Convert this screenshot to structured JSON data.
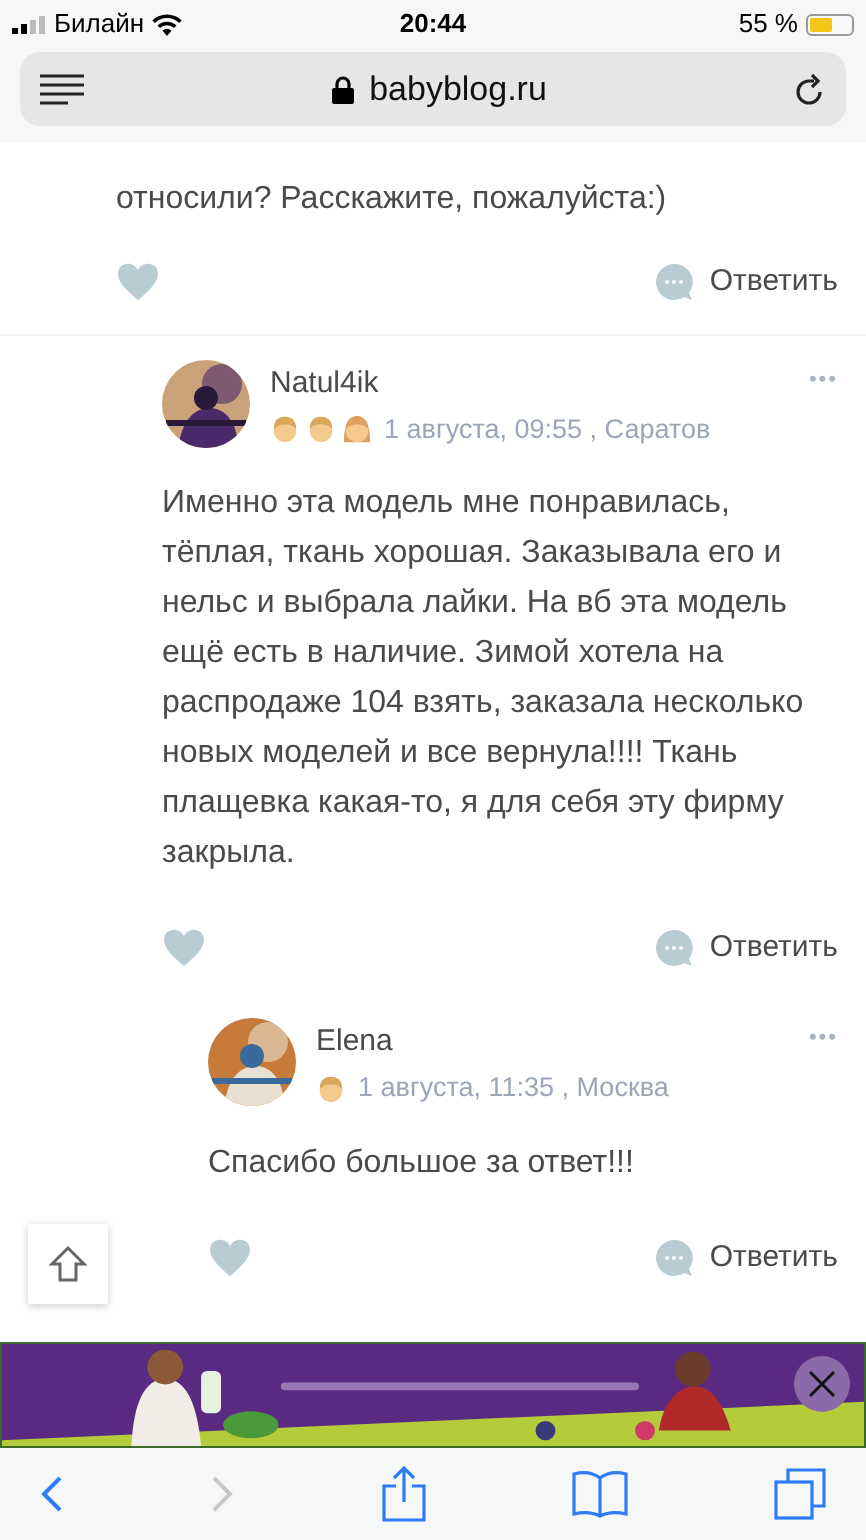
{
  "status_bar": {
    "carrier": "Билайн",
    "time": "20:44",
    "battery": "55 %"
  },
  "address_bar": {
    "url": "babyblog.ru"
  },
  "previous_comment": {
    "text_tail": "относили? Расскажите, пожалуйста:)",
    "like_liked": false,
    "reply": "Ответить",
    "children": [
      {
        "author": "Natul4ik",
        "kids": [
          {
            "kind": "boy"
          },
          {
            "kind": "boy"
          },
          {
            "kind": "girl"
          }
        ],
        "meta": "1 августа, 09:55 , Саратов",
        "more": "•••",
        "text": "Именно эта модель мне понравилась, тёплая, ткань хорошая. Заказывала его и нельс и выбрала лайки. На вб эта модель ещё есть в наличие. Зимой хотела на распродаже 104 взять, заказала несколько новых моделей и все вернула!!!! Ткань плащевка какая-то, я для себя эту фирму закрыла.",
        "like_liked": false,
        "reply": "Ответить",
        "children": [
          {
            "author": "Elena",
            "kids": [
              {
                "kind": "boy"
              }
            ],
            "meta": "1 августа, 11:35 , Москва",
            "more": "•••",
            "text": "Спасибо большое за ответ!!!",
            "like_liked": false,
            "reply": "Ответить"
          }
        ]
      }
    ]
  }
}
